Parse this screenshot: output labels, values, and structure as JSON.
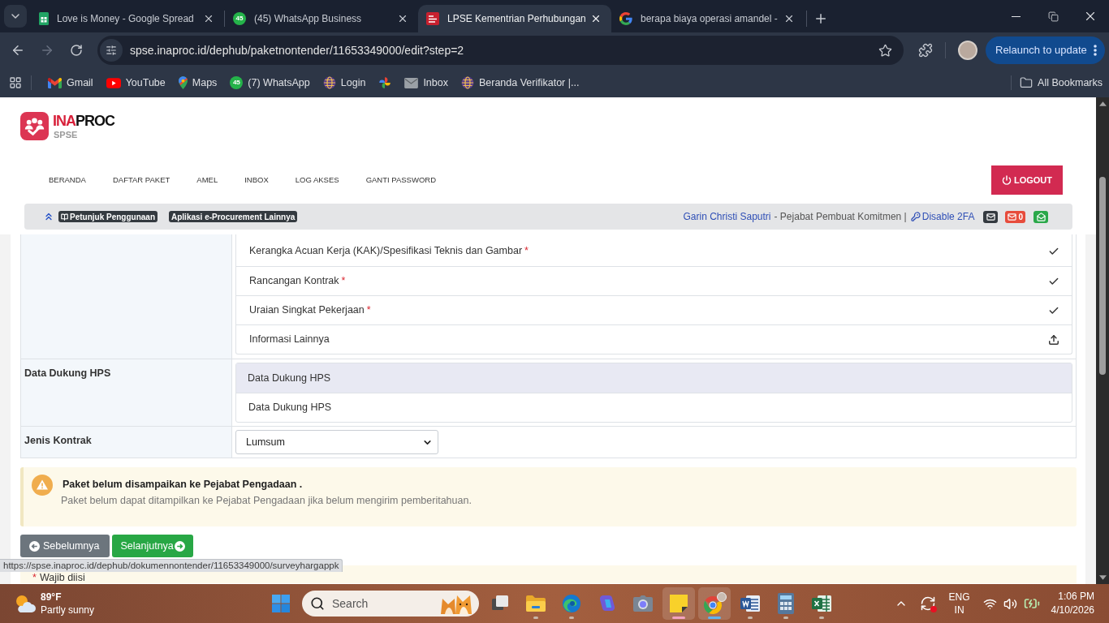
{
  "browser": {
    "tabs": [
      {
        "title": "Love is Money - Google Spread",
        "selected": false
      },
      {
        "title": "(45) WhatsApp Business",
        "badge": "45",
        "selected": false
      },
      {
        "title": "LPSE Kementrian Perhubungan",
        "selected": true
      },
      {
        "title": "berapa biaya operasi amandel -",
        "selected": false
      }
    ],
    "can_go_forward": false,
    "address": "spse.inaproc.id/dephub/paketnontender/11653349000/edit?step=2",
    "relaunch": "Relaunch to update",
    "bookmarks": [
      {
        "kind": "link",
        "label": "Gmail"
      },
      {
        "kind": "link",
        "label": "YouTube"
      },
      {
        "kind": "link",
        "label": "Maps"
      },
      {
        "kind": "link",
        "label": "(7) WhatsApp",
        "badge": "45"
      },
      {
        "kind": "link",
        "label": "Login"
      },
      {
        "kind": "icon"
      },
      {
        "kind": "link",
        "label": "Inbox"
      },
      {
        "kind": "link",
        "label": "Beranda Verifikator |..."
      }
    ],
    "all_bookmarks": "All Bookmarks"
  },
  "site": {
    "logo": {
      "wordmark": [
        "INA",
        "PROC"
      ],
      "subtitle": "SPSE"
    },
    "nav": [
      "BERANDA",
      "DAFTAR PAKET",
      "AMEL",
      "INBOX",
      "LOG AKSES",
      "GANTI PASSWORD"
    ],
    "logout": "LOGOUT",
    "infobar": {
      "links": [
        "Petunjuk Penggunaan",
        "Aplikasi e-Procurement Lainnya"
      ],
      "user": "Garin Christi Saputri",
      "role": "- Pejabat Pembuat Komitmen |",
      "disable_2fa": "Disable 2FA",
      "unread_count": "0"
    }
  },
  "form": {
    "rows": [
      {
        "kind": "documents",
        "items": [
          {
            "name": "Kerangka Acuan Kerja (KAK)/Spesifikasi Teknis dan Gambar",
            "mark": "*",
            "uploaded": true
          },
          {
            "name": "Rancangan Kontrak",
            "mark": "*",
            "uploaded": true
          },
          {
            "name": "Uraian Singkat Pekerjaan",
            "mark": "*",
            "uploaded": true
          },
          {
            "name": "Informasi Lainnya",
            "uploaded": false
          }
        ]
      },
      {
        "kind": "panel",
        "label": "Data Dukung HPS",
        "heading": "Data Dukung HPS",
        "items": [
          "Data Dukung HPS"
        ]
      },
      {
        "kind": "select",
        "label": "Jenis Kontrak",
        "value": "Lumsum"
      }
    ]
  },
  "alert": {
    "title": "Paket belum disampaikan ke Pejabat Pengadaan .",
    "message": "Paket belum dapat ditampilkan ke Pejabat Pengadaan jika belum mengirim pemberitahuan."
  },
  "buttons": [
    {
      "kind": "back",
      "label": "Sebelumnya"
    },
    {
      "kind": "next",
      "label": "Selanjutnya"
    }
  ],
  "note": {
    "mark": "*",
    "text": "Wajib diisi"
  },
  "status_url": "https://spse.inaproc.id/dephub/dokumennontender/11653349000/surveyhargappk",
  "taskbar": {
    "weather": {
      "temperature": "89°F",
      "condition": "Partly sunny"
    },
    "search": {
      "placeholder": "Search"
    },
    "apps": [
      {
        "running": false,
        "selected": false
      },
      {
        "running": true,
        "selected": false
      },
      {
        "running": true,
        "selected": false
      },
      {
        "running": false,
        "selected": false
      },
      {
        "running": false,
        "selected": false
      },
      {
        "running": true,
        "selected": true,
        "color": "#f3a3bf"
      },
      {
        "running": true,
        "selected": true,
        "color": "#5fb4ee"
      },
      {
        "running": true,
        "selected": false
      },
      {
        "running": true,
        "selected": false
      },
      {
        "running": true,
        "selected": false
      }
    ],
    "tray": {
      "language": "ENG",
      "region": "IN",
      "time": "1:06 PM",
      "date": "4/10/2026"
    }
  }
}
